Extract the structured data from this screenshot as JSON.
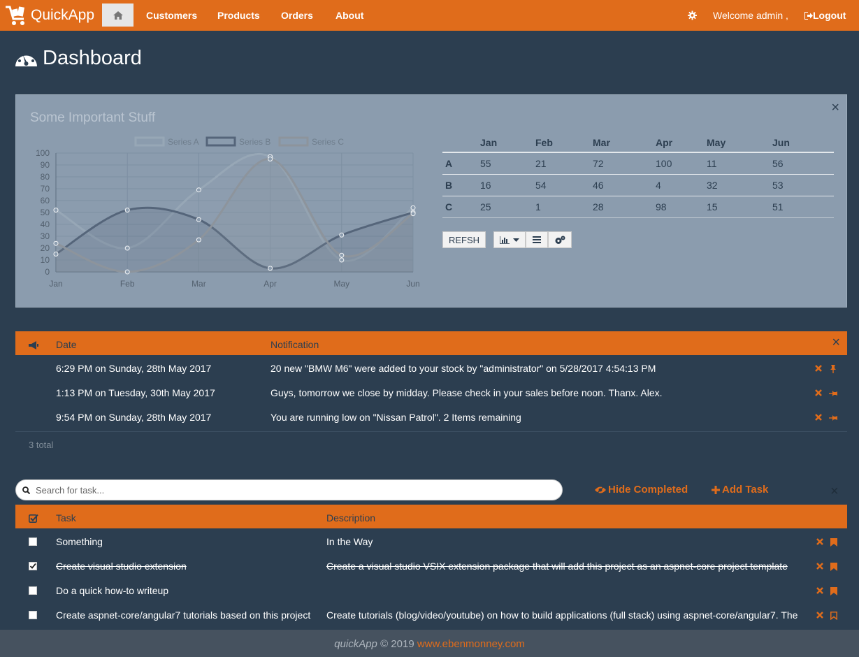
{
  "nav": {
    "brand": "QuickApp",
    "items": [
      "Customers",
      "Products",
      "Orders",
      "About"
    ],
    "welcome": "Welcome admin ,",
    "logout": "Logout"
  },
  "page": {
    "title": "Dashboard"
  },
  "chart_panel": {
    "title": "Some Important Stuff",
    "table": {
      "columns": [
        "Jan",
        "Feb",
        "Mar",
        "Apr",
        "May",
        "Jun"
      ],
      "rows": [
        {
          "label": "A",
          "values": [
            "55",
            "21",
            "72",
            "100",
            "11",
            "56"
          ]
        },
        {
          "label": "B",
          "values": [
            "16",
            "54",
            "46",
            "4",
            "32",
            "53"
          ]
        },
        {
          "label": "C",
          "values": [
            "25",
            "1",
            "28",
            "98",
            "15",
            "51"
          ]
        }
      ]
    },
    "refresh_label": "REFSH"
  },
  "chart_data": {
    "type": "line",
    "categories": [
      "Jan",
      "Feb",
      "Mar",
      "Apr",
      "May",
      "Jun"
    ],
    "series": [
      {
        "name": "Series A",
        "values": [
          52,
          20,
          69,
          97,
          10,
          54
        ],
        "color": "#97a7b6"
      },
      {
        "name": "Series B",
        "values": [
          15,
          52,
          44,
          3,
          31,
          50
        ],
        "color": "#55657a"
      },
      {
        "name": "Series C",
        "values": [
          24,
          0,
          27,
          95,
          14,
          49
        ],
        "color": "#8d949c"
      }
    ],
    "yticks": [
      "0",
      "10",
      "20",
      "30",
      "40",
      "50",
      "60",
      "70",
      "80",
      "90",
      "100"
    ],
    "ylim": [
      0,
      100
    ],
    "legend": "top",
    "grid": true
  },
  "notifications": {
    "headers": {
      "date": "Date",
      "notification": "Notification"
    },
    "rows": [
      {
        "date": "6:29 PM on Sunday, 28th May 2017",
        "text": "20 new \"BMW M6\" were added to your stock by \"administrator\" on 5/28/2017 4:54:13 PM",
        "pinned": true
      },
      {
        "date": "1:13 PM on Tuesday, 30th May 2017",
        "text": "Guys, tomorrow we close by midday. Please check in your sales before noon. Thanx. Alex.",
        "pinned": false
      },
      {
        "date": "9:54 PM on Sunday, 28th May 2017",
        "text": "You are running low on \"Nissan Patrol\". 2 Items remaining",
        "pinned": false
      }
    ],
    "total": "3 total"
  },
  "tasks": {
    "search_placeholder": "Search for task...",
    "hide_completed": "Hide Completed",
    "add_task": "Add Task",
    "headers": {
      "task": "Task",
      "description": "Description"
    },
    "rows": [
      {
        "task": "Something",
        "description": "In the Way",
        "done": false,
        "important": true
      },
      {
        "task": "Create visual studio extension",
        "description": "Create a visual studio VSIX extension package that will add this project as an aspnet-core project template",
        "done": true,
        "important": true
      },
      {
        "task": "Do a quick how-to writeup",
        "description": "",
        "done": false,
        "important": true
      },
      {
        "task": "Create aspnet-core/angular7 tutorials based on this project",
        "description": "Create tutorials (blog/video/youtube) on how to build applications (full stack) using aspnet-core/angular7. The",
        "done": false,
        "important": false
      }
    ]
  },
  "footer": {
    "brand": "quickApp",
    "copyright": " © 2019 ",
    "link": "www.ebenmonney.com"
  }
}
